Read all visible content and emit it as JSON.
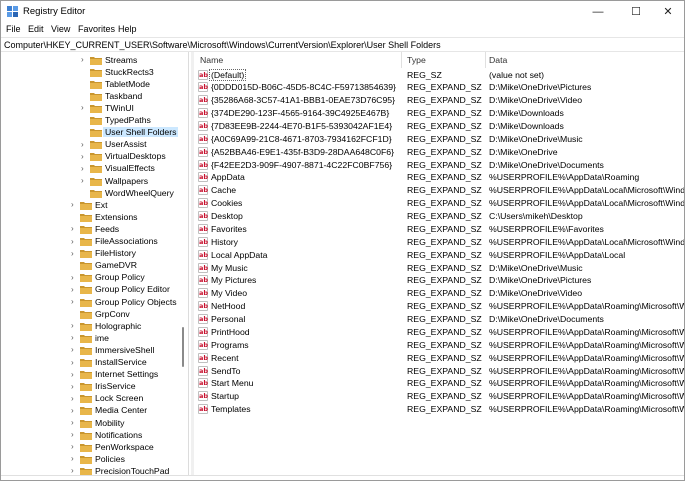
{
  "window": {
    "title": "Registry Editor"
  },
  "titlebar_controls": {
    "minimize": "—",
    "maximize": "☐",
    "close": "✕"
  },
  "menu": [
    "File",
    "Edit",
    "View",
    "Favorites",
    "Help"
  ],
  "address": "Computer\\HKEY_CURRENT_USER\\Software\\Microsoft\\Windows\\CurrentVersion\\Explorer\\User Shell Folders",
  "colors": {
    "selection": "#cce8ff",
    "folder": "#e8b64a",
    "folder_dark": "#c9962e",
    "string_icon": "#c8102e"
  },
  "tree": [
    {
      "label": "Streams",
      "level": 2,
      "expander": true
    },
    {
      "label": "StuckRects3",
      "level": 2,
      "expander": false
    },
    {
      "label": "TabletMode",
      "level": 2,
      "expander": false
    },
    {
      "label": "Taskband",
      "level": 2,
      "expander": false
    },
    {
      "label": "TWinUI",
      "level": 2,
      "expander": true
    },
    {
      "label": "TypedPaths",
      "level": 2,
      "expander": false
    },
    {
      "label": "User Shell Folders",
      "level": 2,
      "expander": false,
      "selected": true
    },
    {
      "label": "UserAssist",
      "level": 2,
      "expander": true
    },
    {
      "label": "VirtualDesktops",
      "level": 2,
      "expander": true
    },
    {
      "label": "VisualEffects",
      "level": 2,
      "expander": true
    },
    {
      "label": "Wallpapers",
      "level": 2,
      "expander": true
    },
    {
      "label": "WordWheelQuery",
      "level": 2,
      "expander": false
    },
    {
      "label": "Ext",
      "level": 1,
      "expander": true
    },
    {
      "label": "Extensions",
      "level": 1,
      "expander": false
    },
    {
      "label": "Feeds",
      "level": 1,
      "expander": true
    },
    {
      "label": "FileAssociations",
      "level": 1,
      "expander": true
    },
    {
      "label": "FileHistory",
      "level": 1,
      "expander": true
    },
    {
      "label": "GameDVR",
      "level": 1,
      "expander": false
    },
    {
      "label": "Group Policy",
      "level": 1,
      "expander": true
    },
    {
      "label": "Group Policy Editor",
      "level": 1,
      "expander": true
    },
    {
      "label": "Group Policy Objects",
      "level": 1,
      "expander": true
    },
    {
      "label": "GrpConv",
      "level": 1,
      "expander": false
    },
    {
      "label": "Holographic",
      "level": 1,
      "expander": true
    },
    {
      "label": "ime",
      "level": 1,
      "expander": true
    },
    {
      "label": "ImmersiveShell",
      "level": 1,
      "expander": true
    },
    {
      "label": "InstallService",
      "level": 1,
      "expander": true
    },
    {
      "label": "Internet Settings",
      "level": 1,
      "expander": true
    },
    {
      "label": "IrisService",
      "level": 1,
      "expander": true
    },
    {
      "label": "Lock Screen",
      "level": 1,
      "expander": true
    },
    {
      "label": "Media Center",
      "level": 1,
      "expander": true
    },
    {
      "label": "Mobility",
      "level": 1,
      "expander": true
    },
    {
      "label": "Notifications",
      "level": 1,
      "expander": true
    },
    {
      "label": "PenWorkspace",
      "level": 1,
      "expander": true
    },
    {
      "label": "Policies",
      "level": 1,
      "expander": true
    },
    {
      "label": "PrecisionTouchPad",
      "level": 1,
      "expander": true
    }
  ],
  "columns": {
    "name": "Name",
    "type": "Type",
    "data": "Data"
  },
  "values": [
    {
      "name": "(Default)",
      "type": "REG_SZ",
      "data": "(value not set)"
    },
    {
      "name": "{0DDD015D-B06C-45D5-8C4C-F59713854639}",
      "type": "REG_EXPAND_SZ",
      "data": "D:\\Mike\\OneDrive\\Pictures"
    },
    {
      "name": "{35286A68-3C57-41A1-BBB1-0EAE73D76C95}",
      "type": "REG_EXPAND_SZ",
      "data": "D:\\Mike\\OneDrive\\Video"
    },
    {
      "name": "{374DE290-123F-4565-9164-39C4925E467B}",
      "type": "REG_EXPAND_SZ",
      "data": "D:\\Mike\\Downloads"
    },
    {
      "name": "{7D83EE9B-2244-4E70-B1F5-5393042AF1E4}",
      "type": "REG_EXPAND_SZ",
      "data": "D:\\Mike\\Downloads"
    },
    {
      "name": "{A0C69A99-21C8-4671-8703-7934162FCF1D}",
      "type": "REG_EXPAND_SZ",
      "data": "D:\\Mike\\OneDrive\\Music"
    },
    {
      "name": "{A52BBA46-E9E1-435f-B3D9-28DAA648C0F6}",
      "type": "REG_EXPAND_SZ",
      "data": "D:\\Mike\\OneDrive"
    },
    {
      "name": "{F42EE2D3-909F-4907-8871-4C22FC0BF756}",
      "type": "REG_EXPAND_SZ",
      "data": "D:\\Mike\\OneDrive\\Documents"
    },
    {
      "name": "AppData",
      "type": "REG_EXPAND_SZ",
      "data": "%USERPROFILE%\\AppData\\Roaming"
    },
    {
      "name": "Cache",
      "type": "REG_EXPAND_SZ",
      "data": "%USERPROFILE%\\AppData\\Local\\Microsoft\\Wind..."
    },
    {
      "name": "Cookies",
      "type": "REG_EXPAND_SZ",
      "data": "%USERPROFILE%\\AppData\\Local\\Microsoft\\Wind..."
    },
    {
      "name": "Desktop",
      "type": "REG_EXPAND_SZ",
      "data": "C:\\Users\\mikeh\\Desktop"
    },
    {
      "name": "Favorites",
      "type": "REG_EXPAND_SZ",
      "data": "%USERPROFILE%\\Favorites"
    },
    {
      "name": "History",
      "type": "REG_EXPAND_SZ",
      "data": "%USERPROFILE%\\AppData\\Local\\Microsoft\\Wind..."
    },
    {
      "name": "Local AppData",
      "type": "REG_EXPAND_SZ",
      "data": "%USERPROFILE%\\AppData\\Local"
    },
    {
      "name": "My Music",
      "type": "REG_EXPAND_SZ",
      "data": "D:\\Mike\\OneDrive\\Music"
    },
    {
      "name": "My Pictures",
      "type": "REG_EXPAND_SZ",
      "data": "D:\\Mike\\OneDrive\\Pictures"
    },
    {
      "name": "My Video",
      "type": "REG_EXPAND_SZ",
      "data": "D:\\Mike\\OneDrive\\Video"
    },
    {
      "name": "NetHood",
      "type": "REG_EXPAND_SZ",
      "data": "%USERPROFILE%\\AppData\\Roaming\\Microsoft\\W..."
    },
    {
      "name": "Personal",
      "type": "REG_EXPAND_SZ",
      "data": "D:\\Mike\\OneDrive\\Documents"
    },
    {
      "name": "PrintHood",
      "type": "REG_EXPAND_SZ",
      "data": "%USERPROFILE%\\AppData\\Roaming\\Microsoft\\W..."
    },
    {
      "name": "Programs",
      "type": "REG_EXPAND_SZ",
      "data": "%USERPROFILE%\\AppData\\Roaming\\Microsoft\\W..."
    },
    {
      "name": "Recent",
      "type": "REG_EXPAND_SZ",
      "data": "%USERPROFILE%\\AppData\\Roaming\\Microsoft\\W..."
    },
    {
      "name": "SendTo",
      "type": "REG_EXPAND_SZ",
      "data": "%USERPROFILE%\\AppData\\Roaming\\Microsoft\\W..."
    },
    {
      "name": "Start Menu",
      "type": "REG_EXPAND_SZ",
      "data": "%USERPROFILE%\\AppData\\Roaming\\Microsoft\\W..."
    },
    {
      "name": "Startup",
      "type": "REG_EXPAND_SZ",
      "data": "%USERPROFILE%\\AppData\\Roaming\\Microsoft\\W..."
    },
    {
      "name": "Templates",
      "type": "REG_EXPAND_SZ",
      "data": "%USERPROFILE%\\AppData\\Roaming\\Microsoft\\W..."
    }
  ]
}
